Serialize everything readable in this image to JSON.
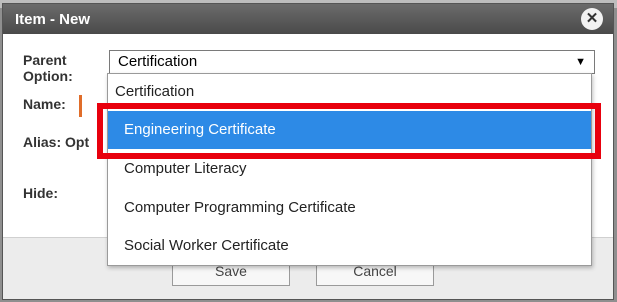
{
  "dialog": {
    "title": "Item - New",
    "close_glyph": "✕"
  },
  "form": {
    "parent_label": "Parent Option:",
    "name_label": "Name:",
    "alias_label": "Alias: Opt",
    "hide_label": "Hide:",
    "parent_value": "Certification",
    "arrow_glyph": "▼"
  },
  "dropdown": {
    "options": [
      "Certification",
      "Engineering Certificate",
      "Computer Literacy",
      "Computer Programming Certificate",
      "Social Worker Certificate"
    ],
    "selected": "Engineering Certificate"
  },
  "buttons": {
    "save": "Save",
    "cancel": "Cancel"
  },
  "colors": {
    "highlight": "#e8000d",
    "selected_option": "#2d8ae6",
    "required_marker": "#e06d2a"
  }
}
